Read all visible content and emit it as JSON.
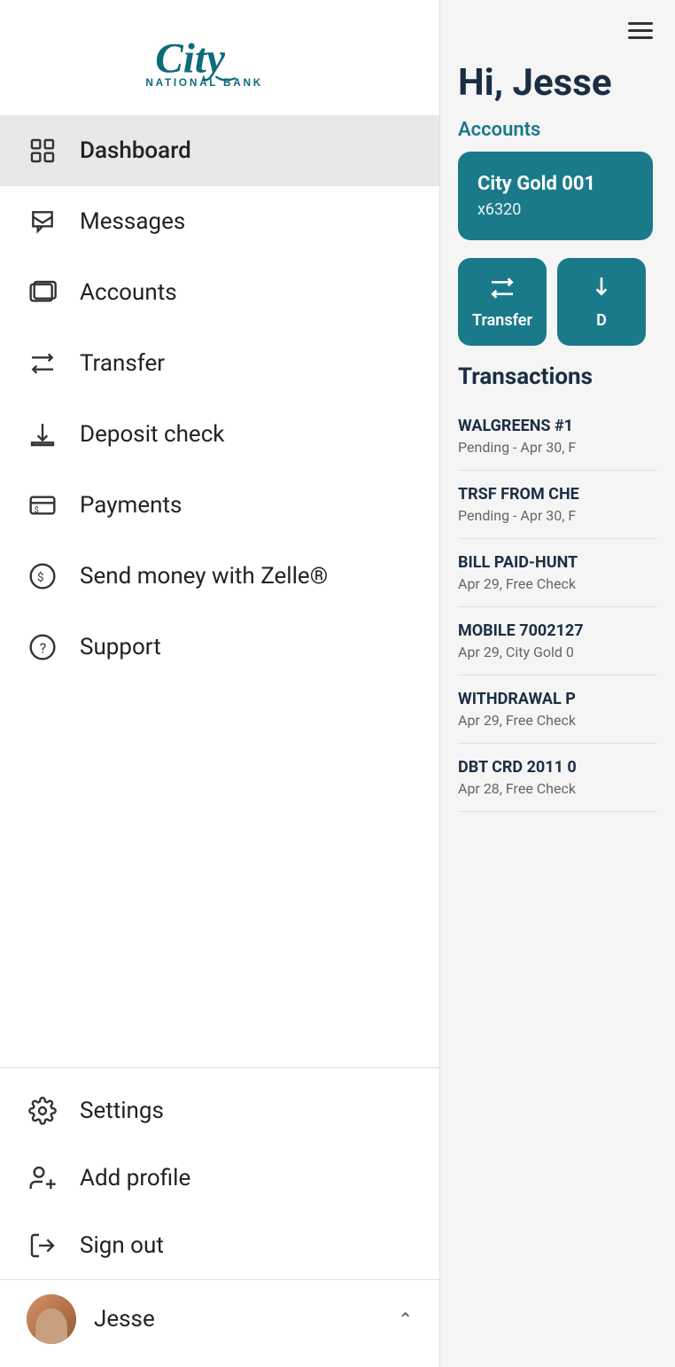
{
  "sidebar": {
    "logo": {
      "alt": "City National Bank"
    },
    "nav_items": [
      {
        "id": "dashboard",
        "label": "Dashboard",
        "icon": "dashboard-icon",
        "active": true
      },
      {
        "id": "messages",
        "label": "Messages",
        "icon": "messages-icon",
        "active": false
      },
      {
        "id": "accounts",
        "label": "Accounts",
        "icon": "accounts-icon",
        "active": false
      },
      {
        "id": "transfer",
        "label": "Transfer",
        "icon": "transfer-icon",
        "active": false
      },
      {
        "id": "deposit-check",
        "label": "Deposit check",
        "icon": "deposit-icon",
        "active": false
      },
      {
        "id": "payments",
        "label": "Payments",
        "icon": "payments-icon",
        "active": false
      },
      {
        "id": "zelle",
        "label": "Send money with Zelle®",
        "icon": "zelle-icon",
        "active": false
      },
      {
        "id": "support",
        "label": "Support",
        "icon": "support-icon",
        "active": false
      }
    ],
    "bottom_items": [
      {
        "id": "settings",
        "label": "Settings",
        "icon": "settings-icon"
      },
      {
        "id": "add-profile",
        "label": "Add profile",
        "icon": "add-profile-icon"
      },
      {
        "id": "sign-out",
        "label": "Sign out",
        "icon": "sign-out-icon"
      }
    ],
    "user": {
      "name": "Jesse",
      "avatar_alt": "Jesse profile photo"
    }
  },
  "main": {
    "hamburger_label": "Menu",
    "greeting": "Hi, Jesse",
    "accounts_section_label": "Accounts",
    "account_card": {
      "name": "City Gold 001",
      "number": "x6320"
    },
    "action_buttons": [
      {
        "id": "transfer-btn",
        "label": "Transfer",
        "icon": "transfer-action-icon"
      },
      {
        "id": "deposit-btn",
        "label": "D",
        "icon": "deposit-action-icon"
      }
    ],
    "transactions": {
      "title": "Transactions",
      "items": [
        {
          "name": "WALGREENS #1",
          "detail": "Pending - Apr 30, F"
        },
        {
          "name": "TRSF FROM CHE",
          "detail": "Pending - Apr 30, F"
        },
        {
          "name": "BILL PAID-HUNT",
          "detail": "Apr 29, Free Check"
        },
        {
          "name": "MOBILE 7002127",
          "detail": "Apr 29, City Gold 0"
        },
        {
          "name": "WITHDRAWAL P",
          "detail": "Apr 29, Free Check"
        },
        {
          "name": "DBT CRD 2011 0",
          "detail": "Apr 28, Free Check"
        }
      ]
    }
  }
}
